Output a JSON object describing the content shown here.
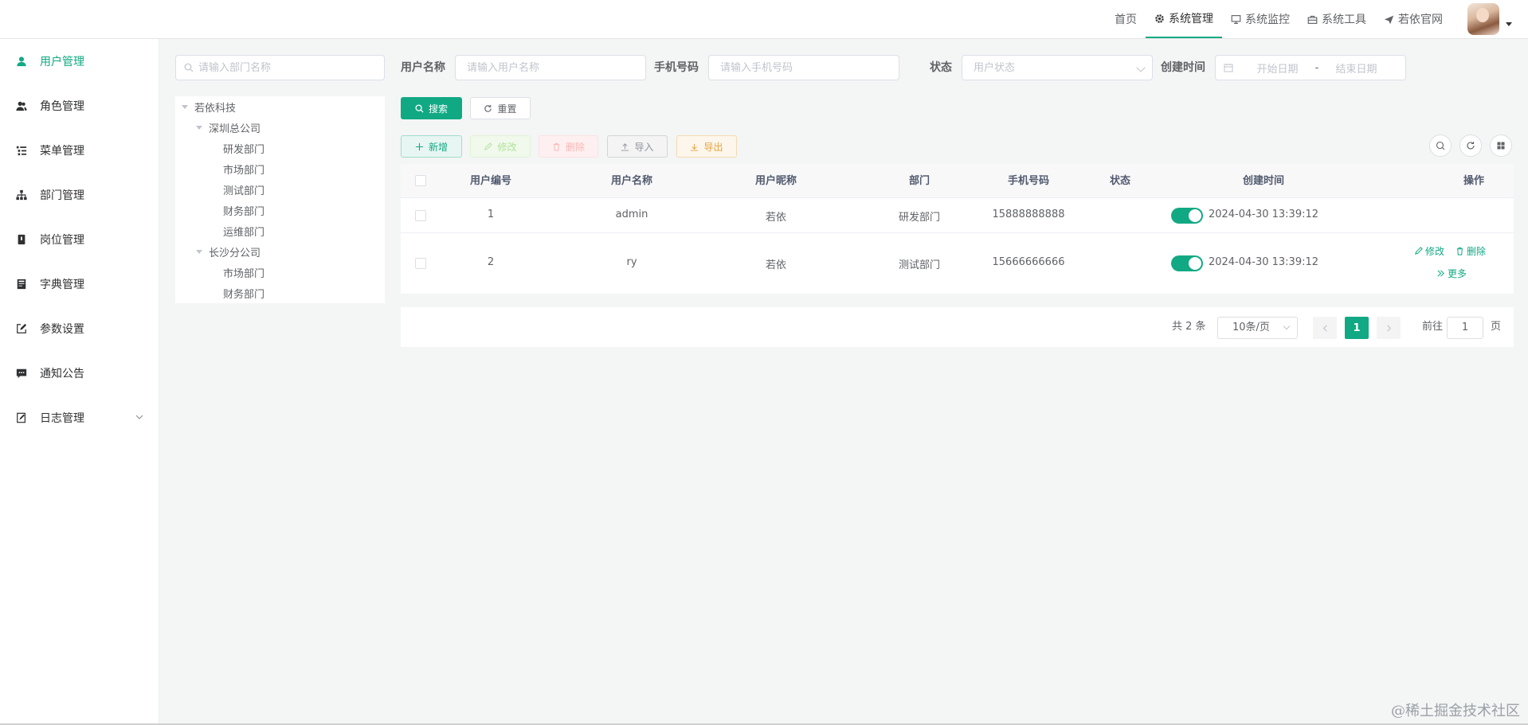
{
  "topnav": {
    "items": [
      {
        "label": "首页",
        "icon": ""
      },
      {
        "label": "系统管理",
        "icon": "gear-icon",
        "active": true
      },
      {
        "label": "系统监控",
        "icon": "monitor-icon"
      },
      {
        "label": "系统工具",
        "icon": "toolbox-icon"
      },
      {
        "label": "若依官网",
        "icon": "send-icon"
      }
    ]
  },
  "sidebar": {
    "items": [
      {
        "label": "用户管理",
        "icon": "user-icon",
        "active": true
      },
      {
        "label": "角色管理",
        "icon": "peoples-icon"
      },
      {
        "label": "菜单管理",
        "icon": "tree-table-icon"
      },
      {
        "label": "部门管理",
        "icon": "org-tree-icon"
      },
      {
        "label": "岗位管理",
        "icon": "post-icon"
      },
      {
        "label": "字典管理",
        "icon": "dict-icon"
      },
      {
        "label": "参数设置",
        "icon": "edit-icon"
      },
      {
        "label": "通知公告",
        "icon": "message-icon"
      },
      {
        "label": "日志管理",
        "icon": "log-icon",
        "expandable": true
      }
    ]
  },
  "dept": {
    "search_placeholder": "请输入部门名称",
    "tree": [
      {
        "label": "若依科技",
        "level": 0,
        "expanded": true
      },
      {
        "label": "深圳总公司",
        "level": 1,
        "expanded": true
      },
      {
        "label": "研发部门",
        "level": 2
      },
      {
        "label": "市场部门",
        "level": 2
      },
      {
        "label": "测试部门",
        "level": 2
      },
      {
        "label": "财务部门",
        "level": 2
      },
      {
        "label": "运维部门",
        "level": 2
      },
      {
        "label": "长沙分公司",
        "level": 1,
        "expanded": true
      },
      {
        "label": "市场部门",
        "level": 2
      },
      {
        "label": "财务部门",
        "level": 2
      }
    ]
  },
  "query": {
    "username_label": "用户名称",
    "username_placeholder": "请输入用户名称",
    "phone_label": "手机号码",
    "phone_placeholder": "请输入手机号码",
    "status_label": "状态",
    "status_placeholder": "用户状态",
    "created_label": "创建时间",
    "start_placeholder": "开始日期",
    "range_sep": "-",
    "end_placeholder": "结束日期",
    "search_label": "搜索",
    "reset_label": "重置"
  },
  "toolbar": {
    "add_label": "新增",
    "edit_label": "修改",
    "delete_label": "删除",
    "import_label": "导入",
    "export_label": "导出"
  },
  "table": {
    "columns": [
      "用户编号",
      "用户名称",
      "用户昵称",
      "部门",
      "手机号码",
      "状态",
      "创建时间",
      "操作"
    ],
    "rows": [
      {
        "id": "1",
        "username": "admin",
        "nickname": "若依",
        "dept": "研发部门",
        "phone": "15888888888",
        "status": true,
        "created": "2024-04-30 13:39:12",
        "actions": []
      },
      {
        "id": "2",
        "username": "ry",
        "nickname": "若依",
        "dept": "测试部门",
        "phone": "15666666666",
        "status": true,
        "created": "2024-04-30 13:39:12",
        "actions": [
          "修改",
          "删除",
          "更多"
        ]
      }
    ]
  },
  "pagination": {
    "total_text": "共 2 条",
    "page_size": "10条/页",
    "current_page": "1",
    "goto_prefix": "前往",
    "goto_value": "1",
    "goto_suffix": "页"
  },
  "watermark": "@稀土掘金技术社区",
  "colors": {
    "primary": "#11a983",
    "sidebar_bg": "#ffffff",
    "main_bg": "#f4f5f5"
  }
}
